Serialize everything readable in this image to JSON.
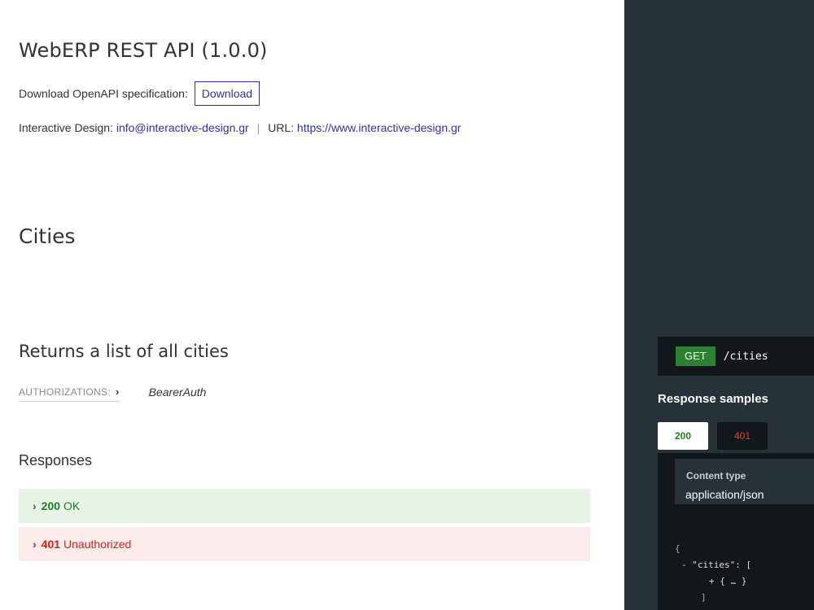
{
  "api": {
    "title": "WebERP REST API (1.0.0)",
    "download_label": "Download OpenAPI specification:",
    "download_button": "Download",
    "contact_prefix": "Interactive Design:",
    "contact_email": "info@interactive-design.gr",
    "separator": "|",
    "url_prefix": "URL:",
    "url": "https://www.interactive-design.gr"
  },
  "section": {
    "title": "Cities"
  },
  "operation": {
    "title": "Returns a list of all cities",
    "authorizations_label": "AUTHORIZATIONS:",
    "auth_chevron": "›",
    "auth_value": "BearerAuth",
    "responses_label": "Responses",
    "responses": [
      {
        "arrow": "›",
        "code": "200",
        "text": "OK"
      },
      {
        "arrow": "›",
        "code": "401",
        "text": "Unauthorized"
      }
    ]
  },
  "right_panel": {
    "method": "GET",
    "path": "/cities",
    "response_samples_label": "Response samples",
    "tabs": [
      "200",
      "401"
    ],
    "content_type_label": "Content type",
    "content_type_value": "application/json",
    "json_lines": [
      "{",
      "- \"cities\": [",
      "+ { … }",
      "]"
    ]
  },
  "colors": {
    "link": "#32329f",
    "success": "#1d8127",
    "error": "#d41f1c",
    "panel_bg": "#263238",
    "get_badge": "#2f8132"
  }
}
